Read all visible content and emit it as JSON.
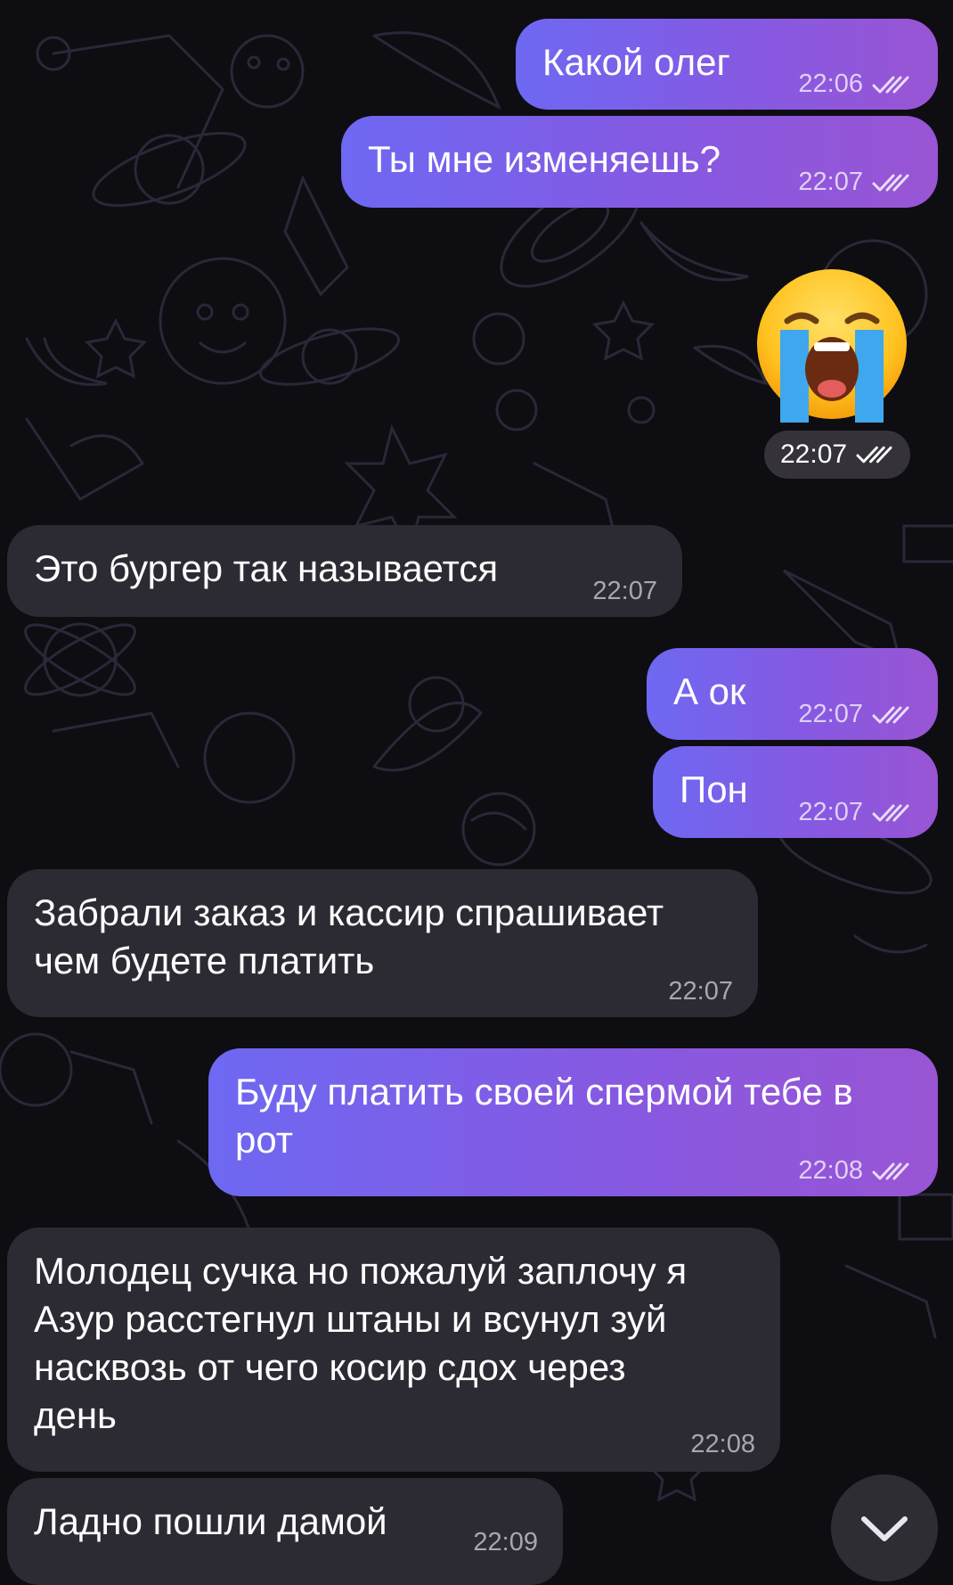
{
  "theme": {
    "background": "#0e0d12",
    "outgoing_gradient": [
      "#6e68f2",
      "#9955d4"
    ],
    "incoming": "#2c2b33",
    "doodle": "#2a2838"
  },
  "messages": [
    {
      "text": "Какой олег",
      "time": "22:06",
      "direction": "out",
      "read": true
    },
    {
      "text": "Ты мне изменяешь?",
      "time": "22:07",
      "direction": "out",
      "read": true
    },
    {
      "emoji": "😭",
      "emoji_name": "loudly-crying-face",
      "time": "22:07",
      "direction": "out",
      "read": true
    },
    {
      "text": "Это бургер так называется",
      "time": "22:07",
      "direction": "in"
    },
    {
      "text": "А ок",
      "time": "22:07",
      "direction": "out",
      "read": true
    },
    {
      "text": "Пон",
      "time": "22:07",
      "direction": "out",
      "read": true
    },
    {
      "text": "Забрали заказ и кассир спрашивает\nчем будете платить",
      "time": "22:07",
      "direction": "in"
    },
    {
      "text": "Буду платить своей спермой тебе в\nрот",
      "time": "22:08",
      "direction": "out",
      "read": true
    },
    {
      "text": "Молодец сучка но пожалуй заплочу я\nАзур расстегнул штаны и всунул зуй\nнасквозь от чего косир сдох через\nдень",
      "time": "22:08",
      "direction": "in"
    },
    {
      "text": "Ладно пошли дамой",
      "time": "22:09",
      "direction": "in"
    }
  ],
  "scroll_down_icon": "chevron-down-icon",
  "read_receipt_icon": "double-check-icon"
}
